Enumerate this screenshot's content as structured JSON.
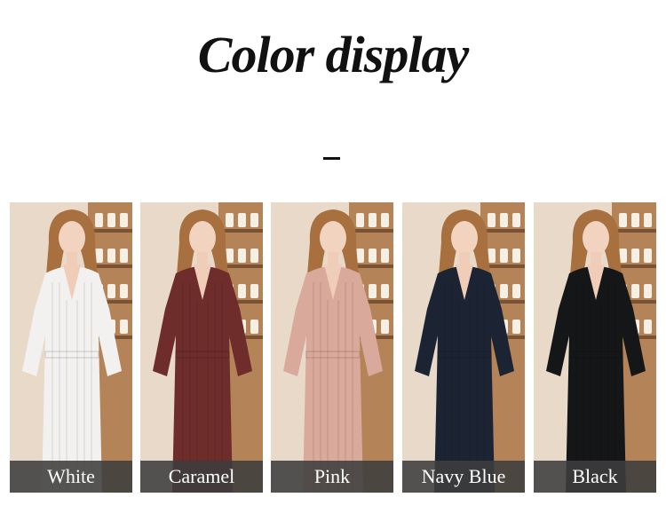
{
  "header": {
    "title": "Color display",
    "divider": "–"
  },
  "swatches": [
    {
      "label": "White",
      "color": "#f3f1ef"
    },
    {
      "label": "Caramel",
      "color": "#6e2d2b"
    },
    {
      "label": "Pink",
      "color": "#d9a99c"
    },
    {
      "label": "Navy Blue",
      "color": "#1c2433"
    },
    {
      "label": "Black",
      "color": "#151617"
    }
  ]
}
